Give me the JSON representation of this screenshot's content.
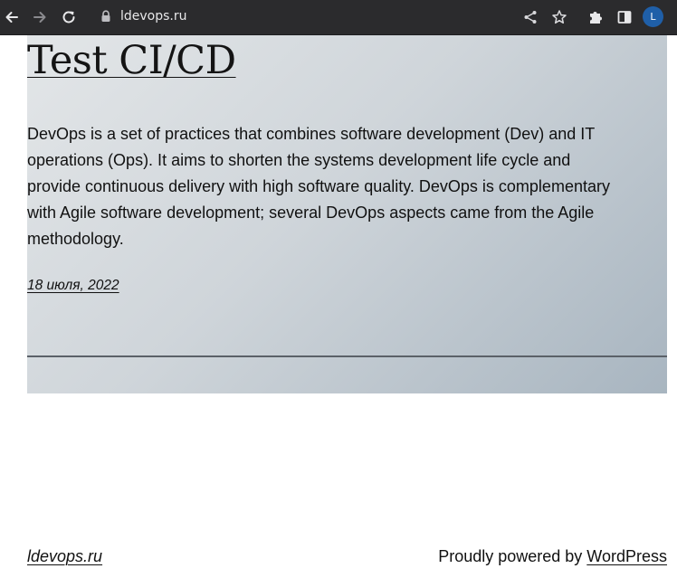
{
  "browser": {
    "url": "ldevops.ru",
    "profile_initial": "L",
    "colors": {
      "toolbar": "#2b2b2d",
      "avatar": "#1f5fa8"
    },
    "icons": [
      "back-arrow-icon",
      "forward-arrow-icon",
      "reload-icon",
      "lock-icon",
      "share-icon",
      "star-icon",
      "extensions-icon",
      "side-panel-icon",
      "profile-avatar"
    ]
  },
  "post": {
    "title": "Test CI/CD",
    "excerpt": "DevOps is a set of practices that combines software development (Dev) and IT operations (Ops). It aims to shorten the systems development life cycle and provide continuous delivery with high software quality. DevOps is complementary with Agile software development; several DevOps aspects came from the Agile methodology.",
    "date": "18 июля, 2022",
    "background_gradient": [
      "#e3e6e8",
      "#cfd5da",
      "#a8b5c0"
    ]
  },
  "footer": {
    "site_name": "ldevops.ru",
    "powered_prefix": "Proudly powered by ",
    "powered_link": "WordPress"
  }
}
